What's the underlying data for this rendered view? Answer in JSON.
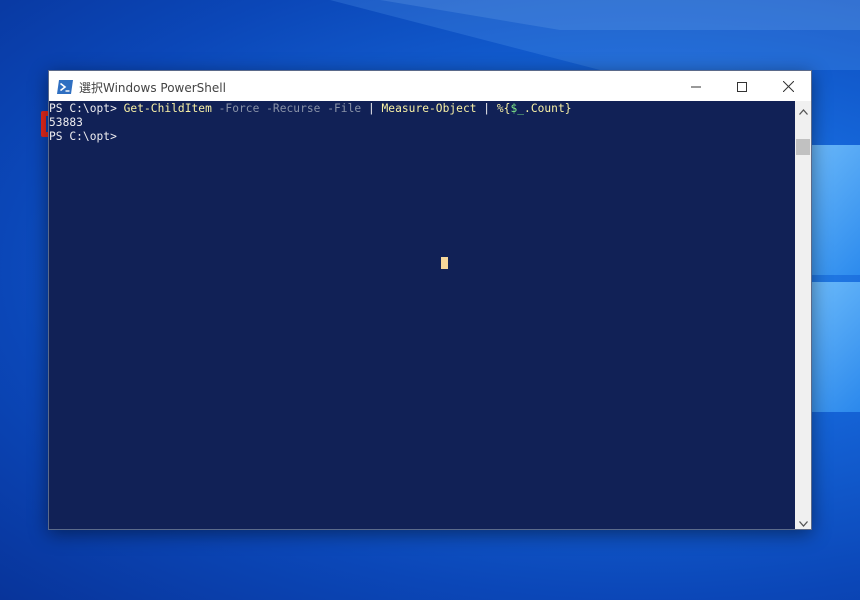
{
  "window": {
    "title": "選択Windows PowerShell"
  },
  "console": {
    "line1": {
      "prompt": "PS C:\\opt> ",
      "cmd1": "Get-ChildItem",
      "args1": " -Force -Recurse -File ",
      "pipe1": "| ",
      "cmd2": "Measure-Object",
      "pipe2": " | ",
      "cmd3": "%{",
      "var": "$_",
      "cmd3b": ".Count}"
    },
    "output": "53883",
    "line3": {
      "prompt": "PS C:\\opt>"
    }
  },
  "icons": {
    "app": "powershell-icon",
    "minimize": "minimize-icon",
    "maximize": "maximize-icon",
    "close": "close-icon",
    "scroll_up": "chevron-up-icon",
    "scroll_down": "chevron-down-icon"
  },
  "colors": {
    "console_bg": "#112156",
    "highlight": "#e8291c",
    "command_yellow": "#f9f1a5",
    "param_gray": "#8a93a8"
  }
}
